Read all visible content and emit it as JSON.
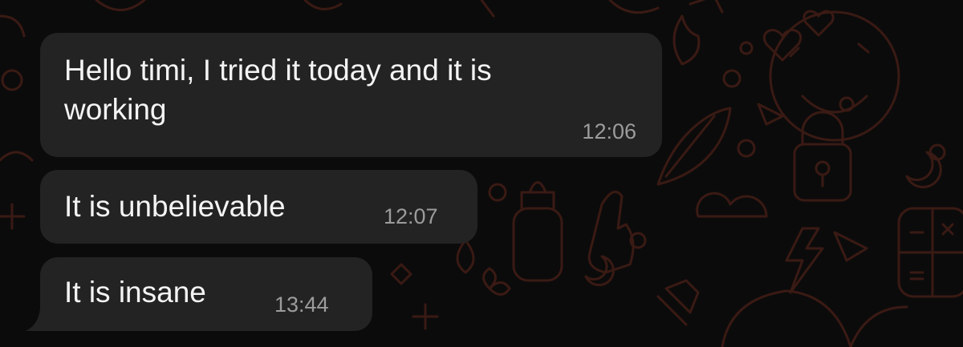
{
  "colors": {
    "background": "#0c0b0b",
    "bubble": "#232323",
    "text": "#f4f4f4",
    "timestamp": "#9c9c9c",
    "wallpaper_doodle": "#3a1a14"
  },
  "messages": [
    {
      "line1": "Hello timi, I tried it today and it is",
      "line2": "working",
      "time": "12:06"
    },
    {
      "line1": "It is unbelievable",
      "time": "12:07"
    },
    {
      "line1": "It is insane",
      "time": "13:44"
    }
  ]
}
